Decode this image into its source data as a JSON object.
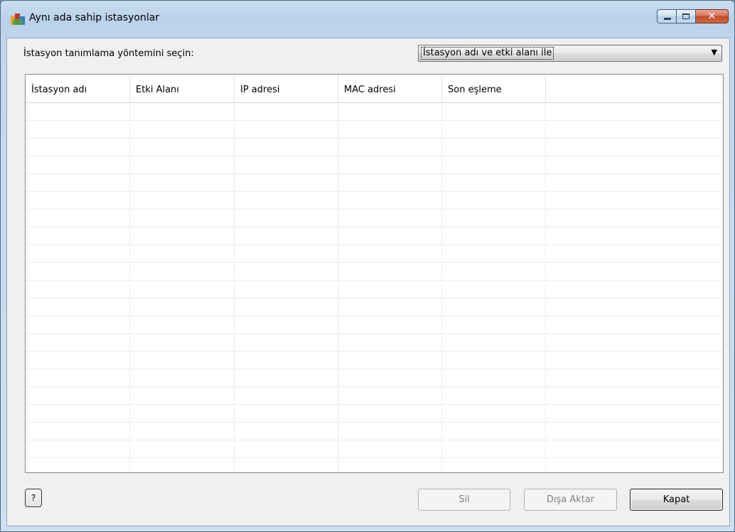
{
  "window": {
    "title": "Aynı ada sahip istasyonlar"
  },
  "filter": {
    "label": "İstasyon tanımlama yöntemini seçin:",
    "selected": "İstasyon adı ve etki alanı ile"
  },
  "table": {
    "columns": [
      "İstasyon adı",
      "Etki Alanı",
      "IP adresi",
      "MAC adresi",
      "Son eşleme",
      ""
    ],
    "rows": []
  },
  "buttons": {
    "help": "?",
    "delete": "Sil",
    "export": "Dışa Aktar",
    "close": "Kapat"
  },
  "icons": {
    "app": "avg-logo-icon",
    "minimize": "minimize-icon",
    "maximize": "maximize-icon",
    "close": "close-icon",
    "dropdown": "chevron-down-icon"
  }
}
